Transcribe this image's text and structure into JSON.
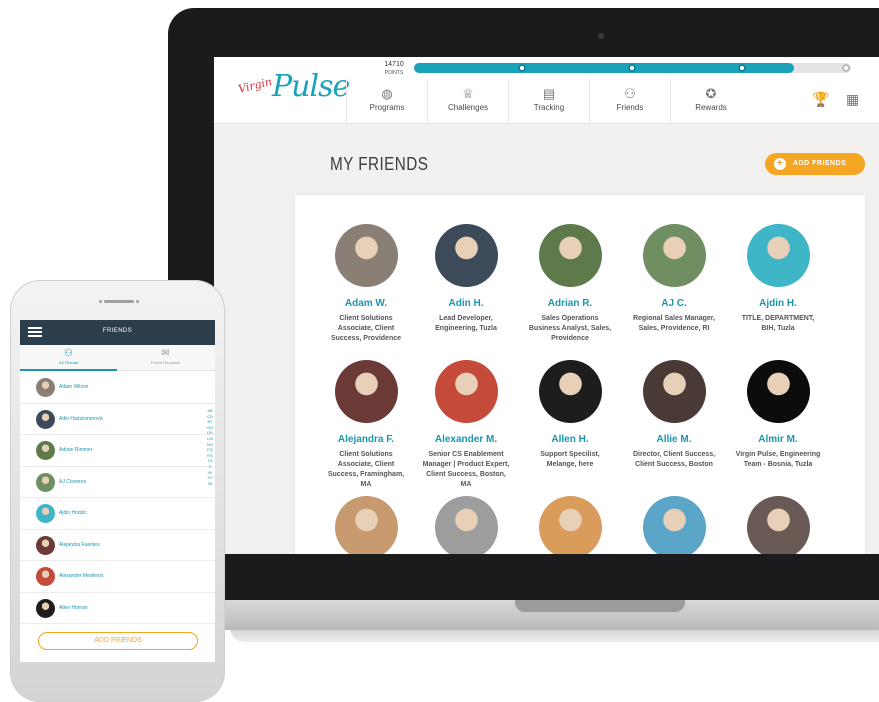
{
  "app": {
    "brand_small": "Virgin",
    "brand_large": "Pulse",
    "points_value": "14710",
    "points_label": "POINTS",
    "progress_fraction": 0.87
  },
  "nav": [
    {
      "label": "Programs",
      "icon": "globe-icon"
    },
    {
      "label": "Challenges",
      "icon": "trophy-icon"
    },
    {
      "label": "Tracking",
      "icon": "calendar-icon"
    },
    {
      "label": "Friends",
      "icon": "friends-icon"
    },
    {
      "label": "Rewards",
      "icon": "rewards-icon"
    }
  ],
  "page": {
    "title": "MY FRIENDS",
    "add_button": "ADD FRIENDS"
  },
  "friends": [
    {
      "name": "Adam W.",
      "title": "Client Solutions Associate, Client Success, Providence",
      "color": "#8a7f74"
    },
    {
      "name": "Adin H.",
      "title": "Lead Developer, Engineering, Tuzla",
      "color": "#3d4a5a"
    },
    {
      "name": "Adrian R.",
      "title": "Sales Operations Business Analyst, Sales, Providence",
      "color": "#5f7a4a"
    },
    {
      "name": "AJ C.",
      "title": "Regional Sales Manager, Sales, Providence, RI",
      "color": "#6f8f62"
    },
    {
      "name": "Ajdin H.",
      "title": "TITLE, DEPARTMENT, BIH, Tuzla",
      "color": "#3fb6c8"
    },
    {
      "name": "Alejandra F.",
      "title": "Client Solutions Associate, Client Success, Framingham, MA",
      "color": "#6b3a36"
    },
    {
      "name": "Alexander M.",
      "title": "Senior CS Enablement Manager | Product Expert, Client Success, Boston, MA",
      "color": "#c44a3a"
    },
    {
      "name": "Allen H.",
      "title": "Support Specilist, Melange, here",
      "color": "#1d1d1d"
    },
    {
      "name": "Allie M.",
      "title": "Director, Client Success, Client Success, Boston",
      "color": "#4a3a35"
    },
    {
      "name": "Almir M.",
      "title": "Virgin Pulse, Engineering Team - Bosnia, Tuzla",
      "color": "#0c0c0c"
    },
    {
      "name": "",
      "title": "",
      "color": "#c89a70"
    },
    {
      "name": "",
      "title": "",
      "color": "#9d9d9d"
    },
    {
      "name": "",
      "title": "",
      "color": "#d99c5a"
    },
    {
      "name": "",
      "title": "",
      "color": "#5aa5c8"
    },
    {
      "name": "",
      "title": "",
      "color": "#6a5a55"
    }
  ],
  "phone": {
    "title": "FRIENDS",
    "tab_all": "All Friends",
    "tab_requests": "Friend Requests",
    "list": [
      {
        "name": "Adam Wilson",
        "color": "#8a7f74"
      },
      {
        "name": "Adin Hadzismerovic",
        "color": "#3d4a5a"
      },
      {
        "name": "Adrian Rimmer",
        "color": "#5f7a4a"
      },
      {
        "name": "AJ Cisneros",
        "color": "#6f8f62"
      },
      {
        "name": "Ajdin Hodzic",
        "color": "#3fb6c8"
      },
      {
        "name": "Alejandra Fuentes",
        "color": "#6b3a36"
      },
      {
        "name": "Alexander Medeiros",
        "color": "#c44a3a"
      },
      {
        "name": "Allen Homan",
        "color": "#1d1d1d"
      }
    ],
    "alphabet": "ABCDEFGHIJKLMNOPQRSTUVWXYZ#",
    "add_button": "ADD FRIENDS"
  }
}
